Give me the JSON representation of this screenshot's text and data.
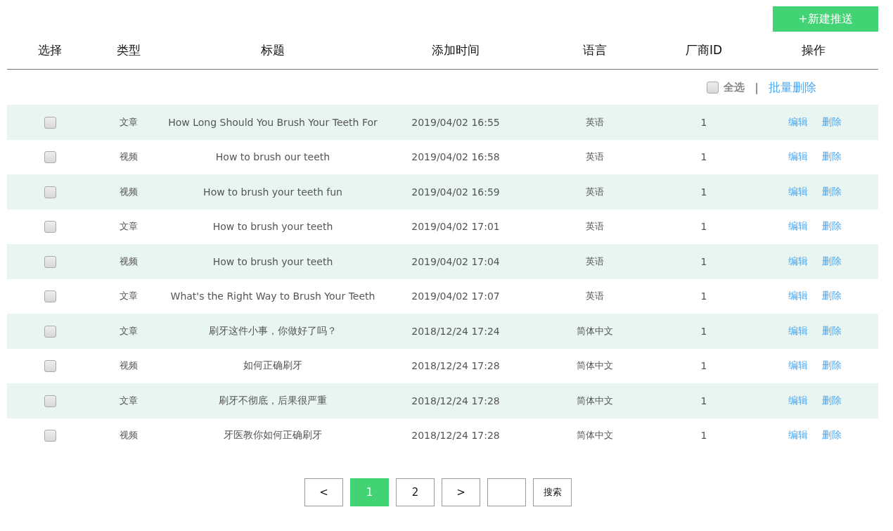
{
  "new_button": "+新建推送",
  "table": {
    "columns": [
      "选择",
      "类型",
      "标题",
      "添加时间",
      "语言",
      "厂商ID",
      "操作"
    ],
    "select_all": {
      "label": "全选",
      "checked": false,
      "separator": "|",
      "bulk_delete": "批量删除"
    },
    "rows": [
      {
        "checked": false,
        "type": "文章",
        "title": "How Long Should You Brush Your Teeth For",
        "time": "2019/04/02 16:55",
        "language": "英语",
        "vendor_id": "1",
        "edit": "编辑",
        "delete": "删除"
      },
      {
        "checked": false,
        "type": "视频",
        "title": "How to brush our teeth",
        "time": "2019/04/02 16:58",
        "language": "英语",
        "vendor_id": "1",
        "edit": "编辑",
        "delete": "删除"
      },
      {
        "checked": false,
        "type": "视频",
        "title": "How to brush your teeth fun",
        "time": "2019/04/02 16:59",
        "language": "英语",
        "vendor_id": "1",
        "edit": "编辑",
        "delete": "删除"
      },
      {
        "checked": false,
        "type": "文章",
        "title": "How to brush your teeth",
        "time": "2019/04/02 17:01",
        "language": "英语",
        "vendor_id": "1",
        "edit": "编辑",
        "delete": "删除"
      },
      {
        "checked": false,
        "type": "视频",
        "title": "How to brush your teeth",
        "time": "2019/04/02 17:04",
        "language": "英语",
        "vendor_id": "1",
        "edit": "编辑",
        "delete": "删除"
      },
      {
        "checked": false,
        "type": "文章",
        "title": "What's the Right Way to Brush Your Teeth",
        "time": "2019/04/02 17:07",
        "language": "英语",
        "vendor_id": "1",
        "edit": "编辑",
        "delete": "删除"
      },
      {
        "checked": false,
        "type": "文章",
        "title": "刷牙这件小事，你做好了吗？",
        "time": "2018/12/24 17:24",
        "language": "简体中文",
        "vendor_id": "1",
        "edit": "编辑",
        "delete": "删除"
      },
      {
        "checked": false,
        "type": "视频",
        "title": "如何正确刷牙",
        "time": "2018/12/24 17:28",
        "language": "简体中文",
        "vendor_id": "1",
        "edit": "编辑",
        "delete": "删除"
      },
      {
        "checked": false,
        "type": "文章",
        "title": "刷牙不彻底，后果很严重",
        "time": "2018/12/24 17:28",
        "language": "简体中文",
        "vendor_id": "1",
        "edit": "编辑",
        "delete": "删除"
      },
      {
        "checked": false,
        "type": "视频",
        "title": "牙医教你如何正确刷牙",
        "time": "2018/12/24 17:28",
        "language": "简体中文",
        "vendor_id": "1",
        "edit": "编辑",
        "delete": "删除"
      }
    ]
  },
  "pagination": {
    "prev": "<",
    "pages": [
      {
        "label": "1",
        "selected": true
      },
      {
        "label": "2",
        "selected": false
      }
    ],
    "next": ">",
    "search_button": "搜索"
  }
}
